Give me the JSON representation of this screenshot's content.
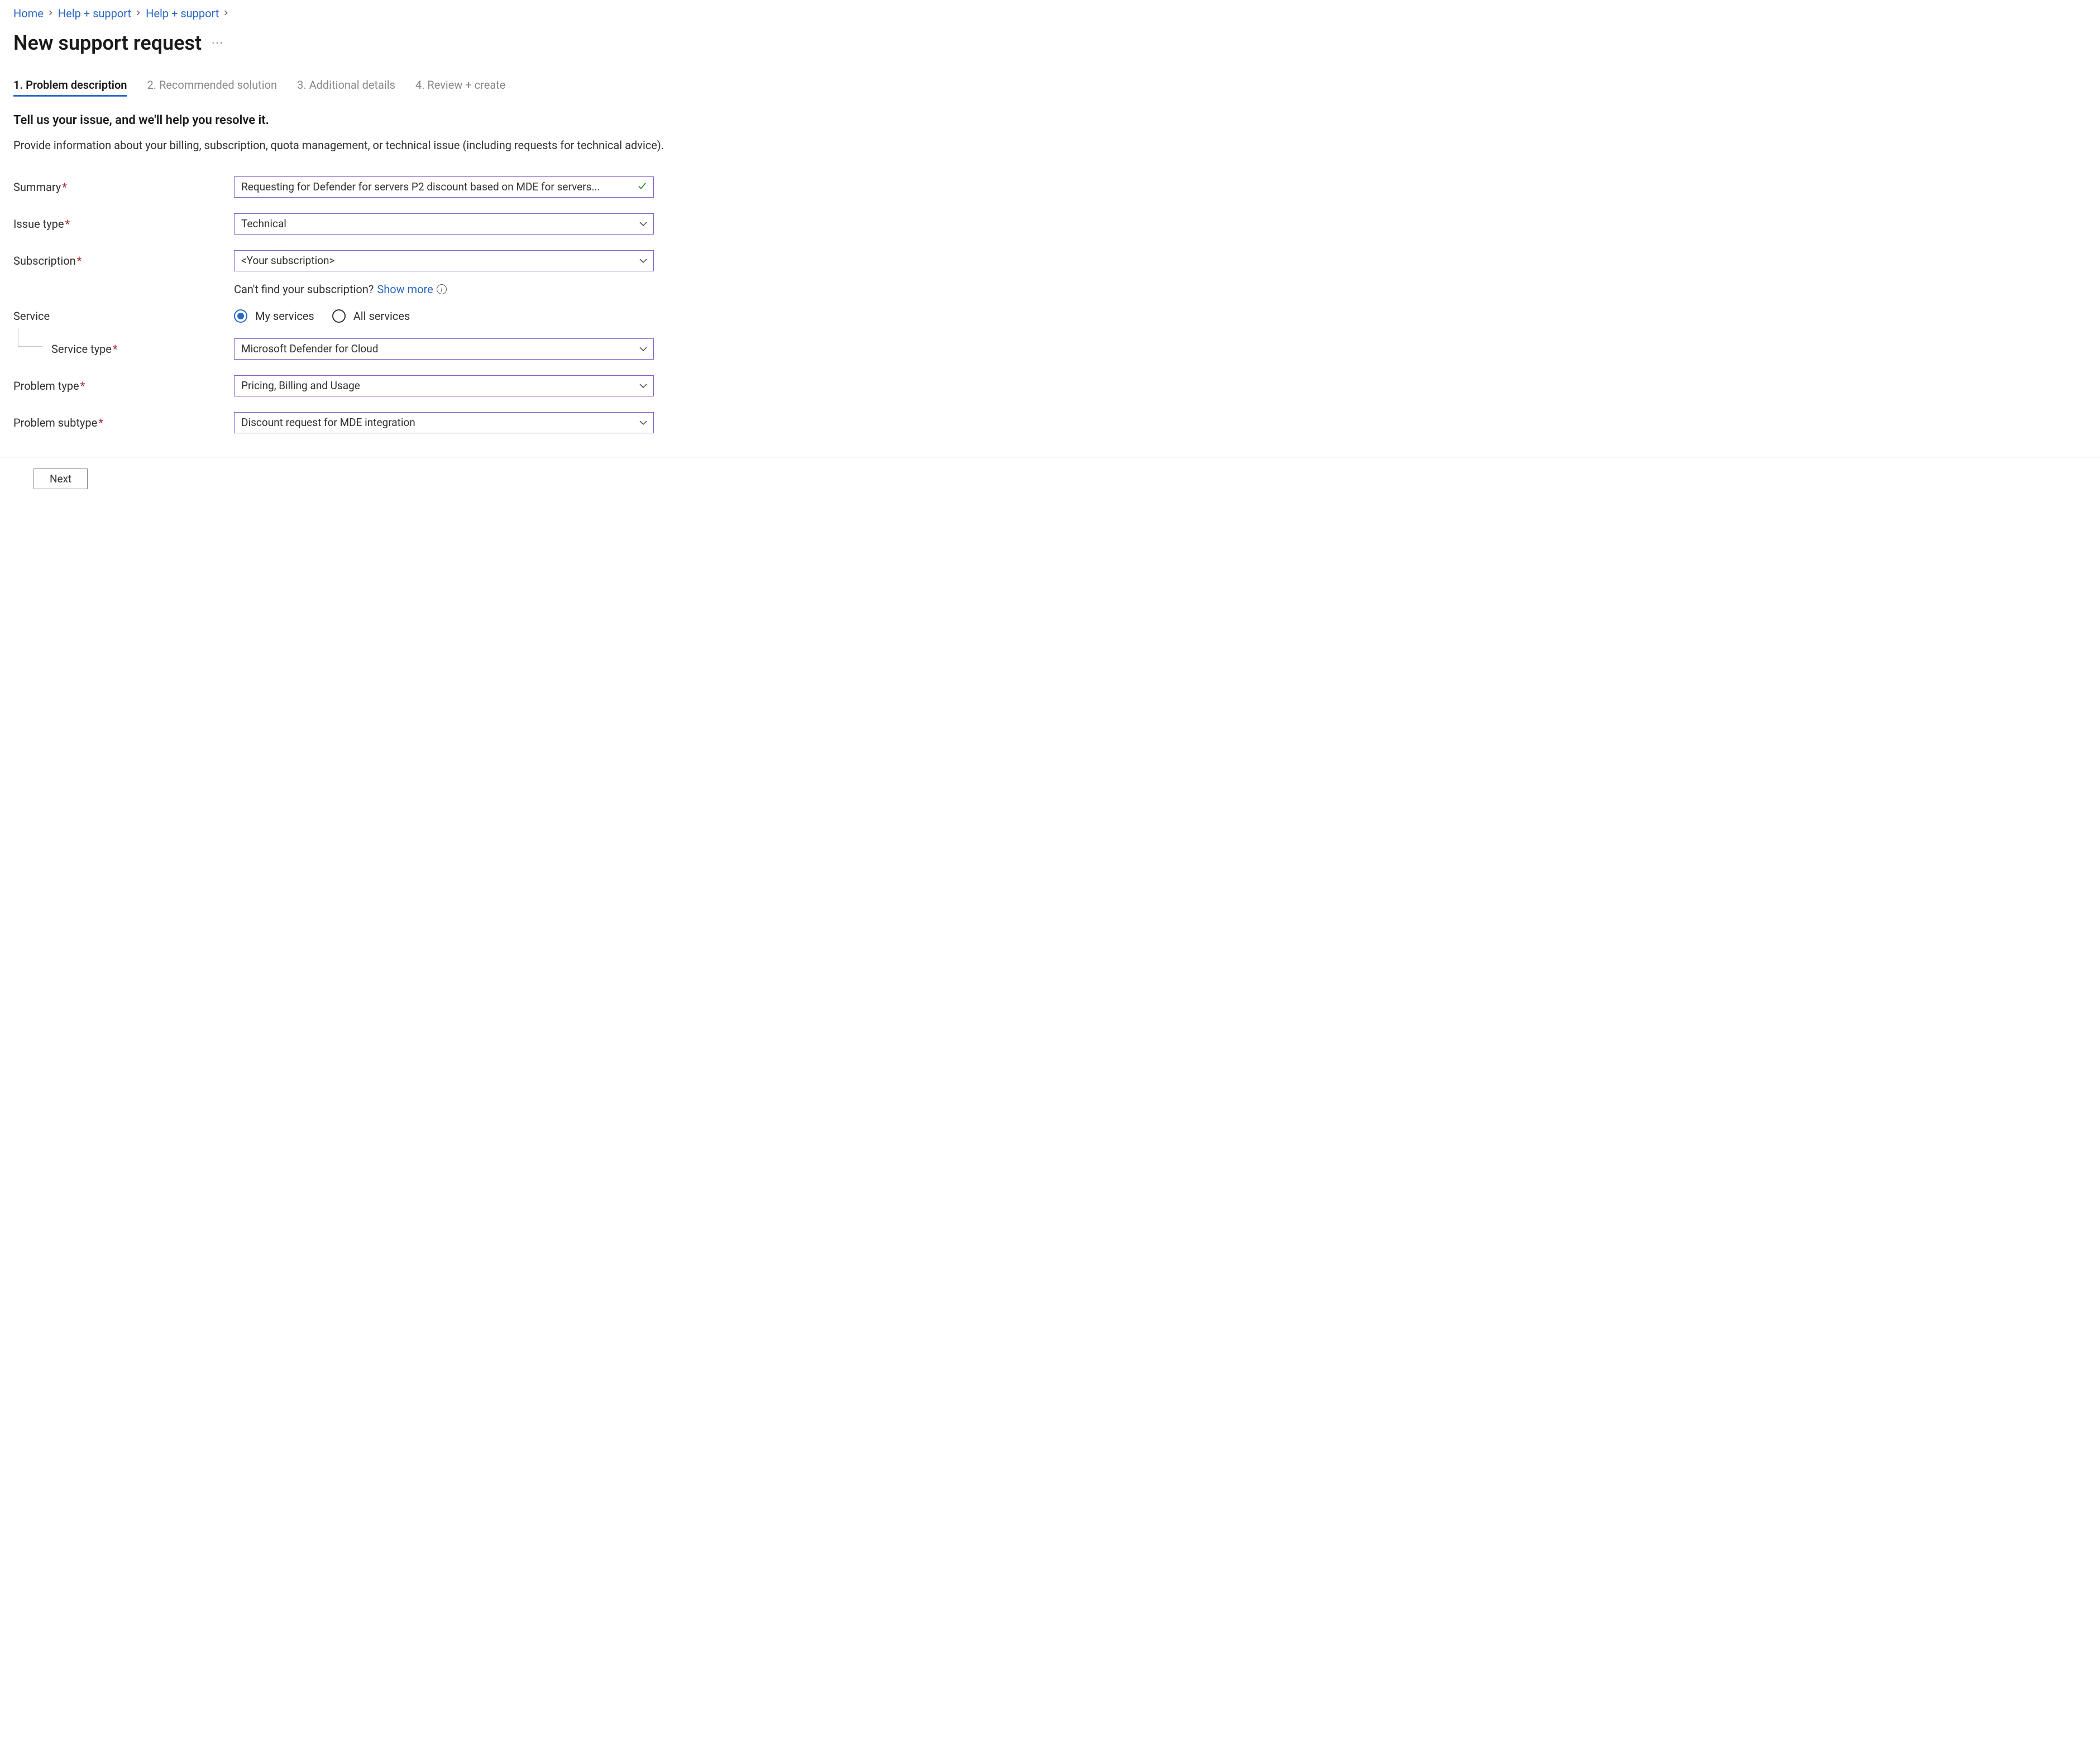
{
  "breadcrumb": {
    "items": [
      "Home",
      "Help + support",
      "Help + support"
    ]
  },
  "page": {
    "title": "New support request"
  },
  "tabs": [
    {
      "label": "1. Problem description",
      "active": true
    },
    {
      "label": "2. Recommended solution",
      "active": false
    },
    {
      "label": "3. Additional details",
      "active": false
    },
    {
      "label": "4. Review + create",
      "active": false
    }
  ],
  "section": {
    "heading": "Tell us your issue, and we'll help you resolve it.",
    "description": "Provide information about your billing, subscription, quota management, or technical issue (including requests for technical advice)."
  },
  "form": {
    "summary": {
      "label": "Summary",
      "value": "Requesting for Defender for servers P2 discount based on MDE for servers..."
    },
    "issueType": {
      "label": "Issue type",
      "value": "Technical"
    },
    "subscription": {
      "label": "Subscription",
      "value": "<Your subscription>",
      "helperPrefix": "Can't find your subscription? ",
      "helperLink": "Show more"
    },
    "service": {
      "label": "Service",
      "options": [
        {
          "label": "My services",
          "checked": true
        },
        {
          "label": "All services",
          "checked": false
        }
      ]
    },
    "serviceType": {
      "label": "Service type",
      "value": "Microsoft Defender for Cloud"
    },
    "problemType": {
      "label": "Problem type",
      "value": "Pricing, Billing and Usage"
    },
    "problemSubtype": {
      "label": "Problem subtype",
      "value": "Discount request for MDE integration"
    }
  },
  "footer": {
    "next": "Next"
  }
}
